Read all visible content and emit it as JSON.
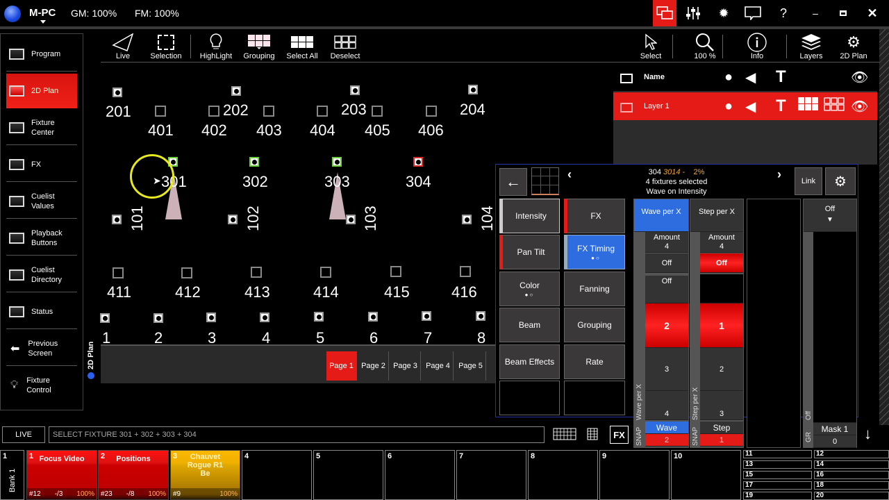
{
  "topbar": {
    "app_name": "M-PC",
    "gm": "GM: 100%",
    "fm": "FM: 100%",
    "icons": [
      "windows-icon",
      "faders-icon",
      "sun-icon",
      "chat-icon",
      "help-icon",
      "minimize-icon",
      "maximize-icon",
      "close-icon"
    ],
    "help": "?",
    "minimize": "–",
    "close": "✕"
  },
  "sidebar": {
    "items": [
      {
        "label": "Program"
      },
      {
        "label": "2D Plan",
        "active": true
      },
      {
        "label": "Fixture Center"
      },
      {
        "label": "FX"
      },
      {
        "label": "Cuelist Values"
      },
      {
        "label": "Playback Buttons"
      },
      {
        "label": "Cuelist Directory"
      },
      {
        "label": "Status"
      },
      {
        "label": "Previous Screen"
      },
      {
        "label": "Fixture Control"
      }
    ]
  },
  "toolbar": {
    "live": "Live",
    "selection": "Selection",
    "highlight": "HighLight",
    "grouping": "Grouping",
    "select_all": "Select All",
    "deselect": "Deselect",
    "select": "Select",
    "zoom": "100 %",
    "info": "Info",
    "layers": "Layers",
    "plan": "2D Plan"
  },
  "plan": {
    "row200": [
      "201",
      "202",
      "203",
      "204"
    ],
    "row400": [
      "401",
      "402",
      "403",
      "404",
      "405",
      "406"
    ],
    "row300": [
      "301",
      "302",
      "303",
      "304"
    ],
    "row100": [
      "101",
      "102",
      "103",
      "104"
    ],
    "row410": [
      "411",
      "412",
      "413",
      "414",
      "415",
      "416"
    ],
    "row1": [
      "1",
      "2",
      "3",
      "4",
      "5",
      "6",
      "7",
      "8"
    ],
    "vtab": "2D Plan"
  },
  "pages": [
    "Page 1",
    "Page 2",
    "Page 3",
    "Page 4",
    "Page 5"
  ],
  "layers": {
    "header": "Name",
    "layer": "Layer 1"
  },
  "fxpanel": {
    "line1_a": "304",
    "line1_b": "3014 -",
    "line1_c": "2%",
    "line2": "4 fixtures selected",
    "line3": "Wave on Intensity",
    "link": "Link",
    "buttons": [
      "Intensity",
      "FX",
      "Pan Tilt",
      "FX Timing",
      "Color",
      "Fanning",
      "Beam",
      "Grouping",
      "Beam Effects",
      "Rate"
    ],
    "wave": {
      "title": "Wave per X",
      "amount_label": "Amount",
      "amount": "4",
      "off": "Off",
      "list": [
        "Off",
        "2",
        "3",
        "4"
      ],
      "vlabel": "Wave per X",
      "snap": "SNAP",
      "mode": "Wave",
      "value": "2"
    },
    "step": {
      "title": "Step per X",
      "amount_label": "Amount",
      "amount": "4",
      "off": "Off",
      "list": [
        "",
        "1",
        "2",
        "3"
      ],
      "vlabel": "Step per X",
      "snap": "SNAP",
      "mode": "Step",
      "value": "1"
    },
    "group": {
      "title": "Off",
      "vlabel": "Off",
      "gr": "GR",
      "mask": "Mask 1",
      "value": "0"
    }
  },
  "command": {
    "mode": "LIVE",
    "text": "SELECT FIXTURE 301 + 302 + 303 + 304",
    "fx": "FX"
  },
  "playbacks": {
    "bank": "Bank 1",
    "bank_num": "1",
    "items": [
      {
        "num": "1",
        "title": "Focus Video",
        "cue": "#12",
        "count": "-/3",
        "level": "100%",
        "color": "#e41b17"
      },
      {
        "num": "2",
        "title": "Positions",
        "cue": "#23",
        "count": "-/8",
        "level": "100%",
        "color": "#e41b17"
      },
      {
        "num": "3",
        "title": "Chauvet Rogue R1 Be",
        "cue": "#9",
        "count": "",
        "level": "100%",
        "color": "#f5b400"
      },
      {
        "num": "4"
      },
      {
        "num": "5"
      },
      {
        "num": "6"
      },
      {
        "num": "7"
      },
      {
        "num": "8"
      },
      {
        "num": "9"
      },
      {
        "num": "10"
      }
    ],
    "mini": [
      "11",
      "12",
      "13",
      "14",
      "15",
      "16",
      "17",
      "18",
      "19",
      "20"
    ]
  }
}
